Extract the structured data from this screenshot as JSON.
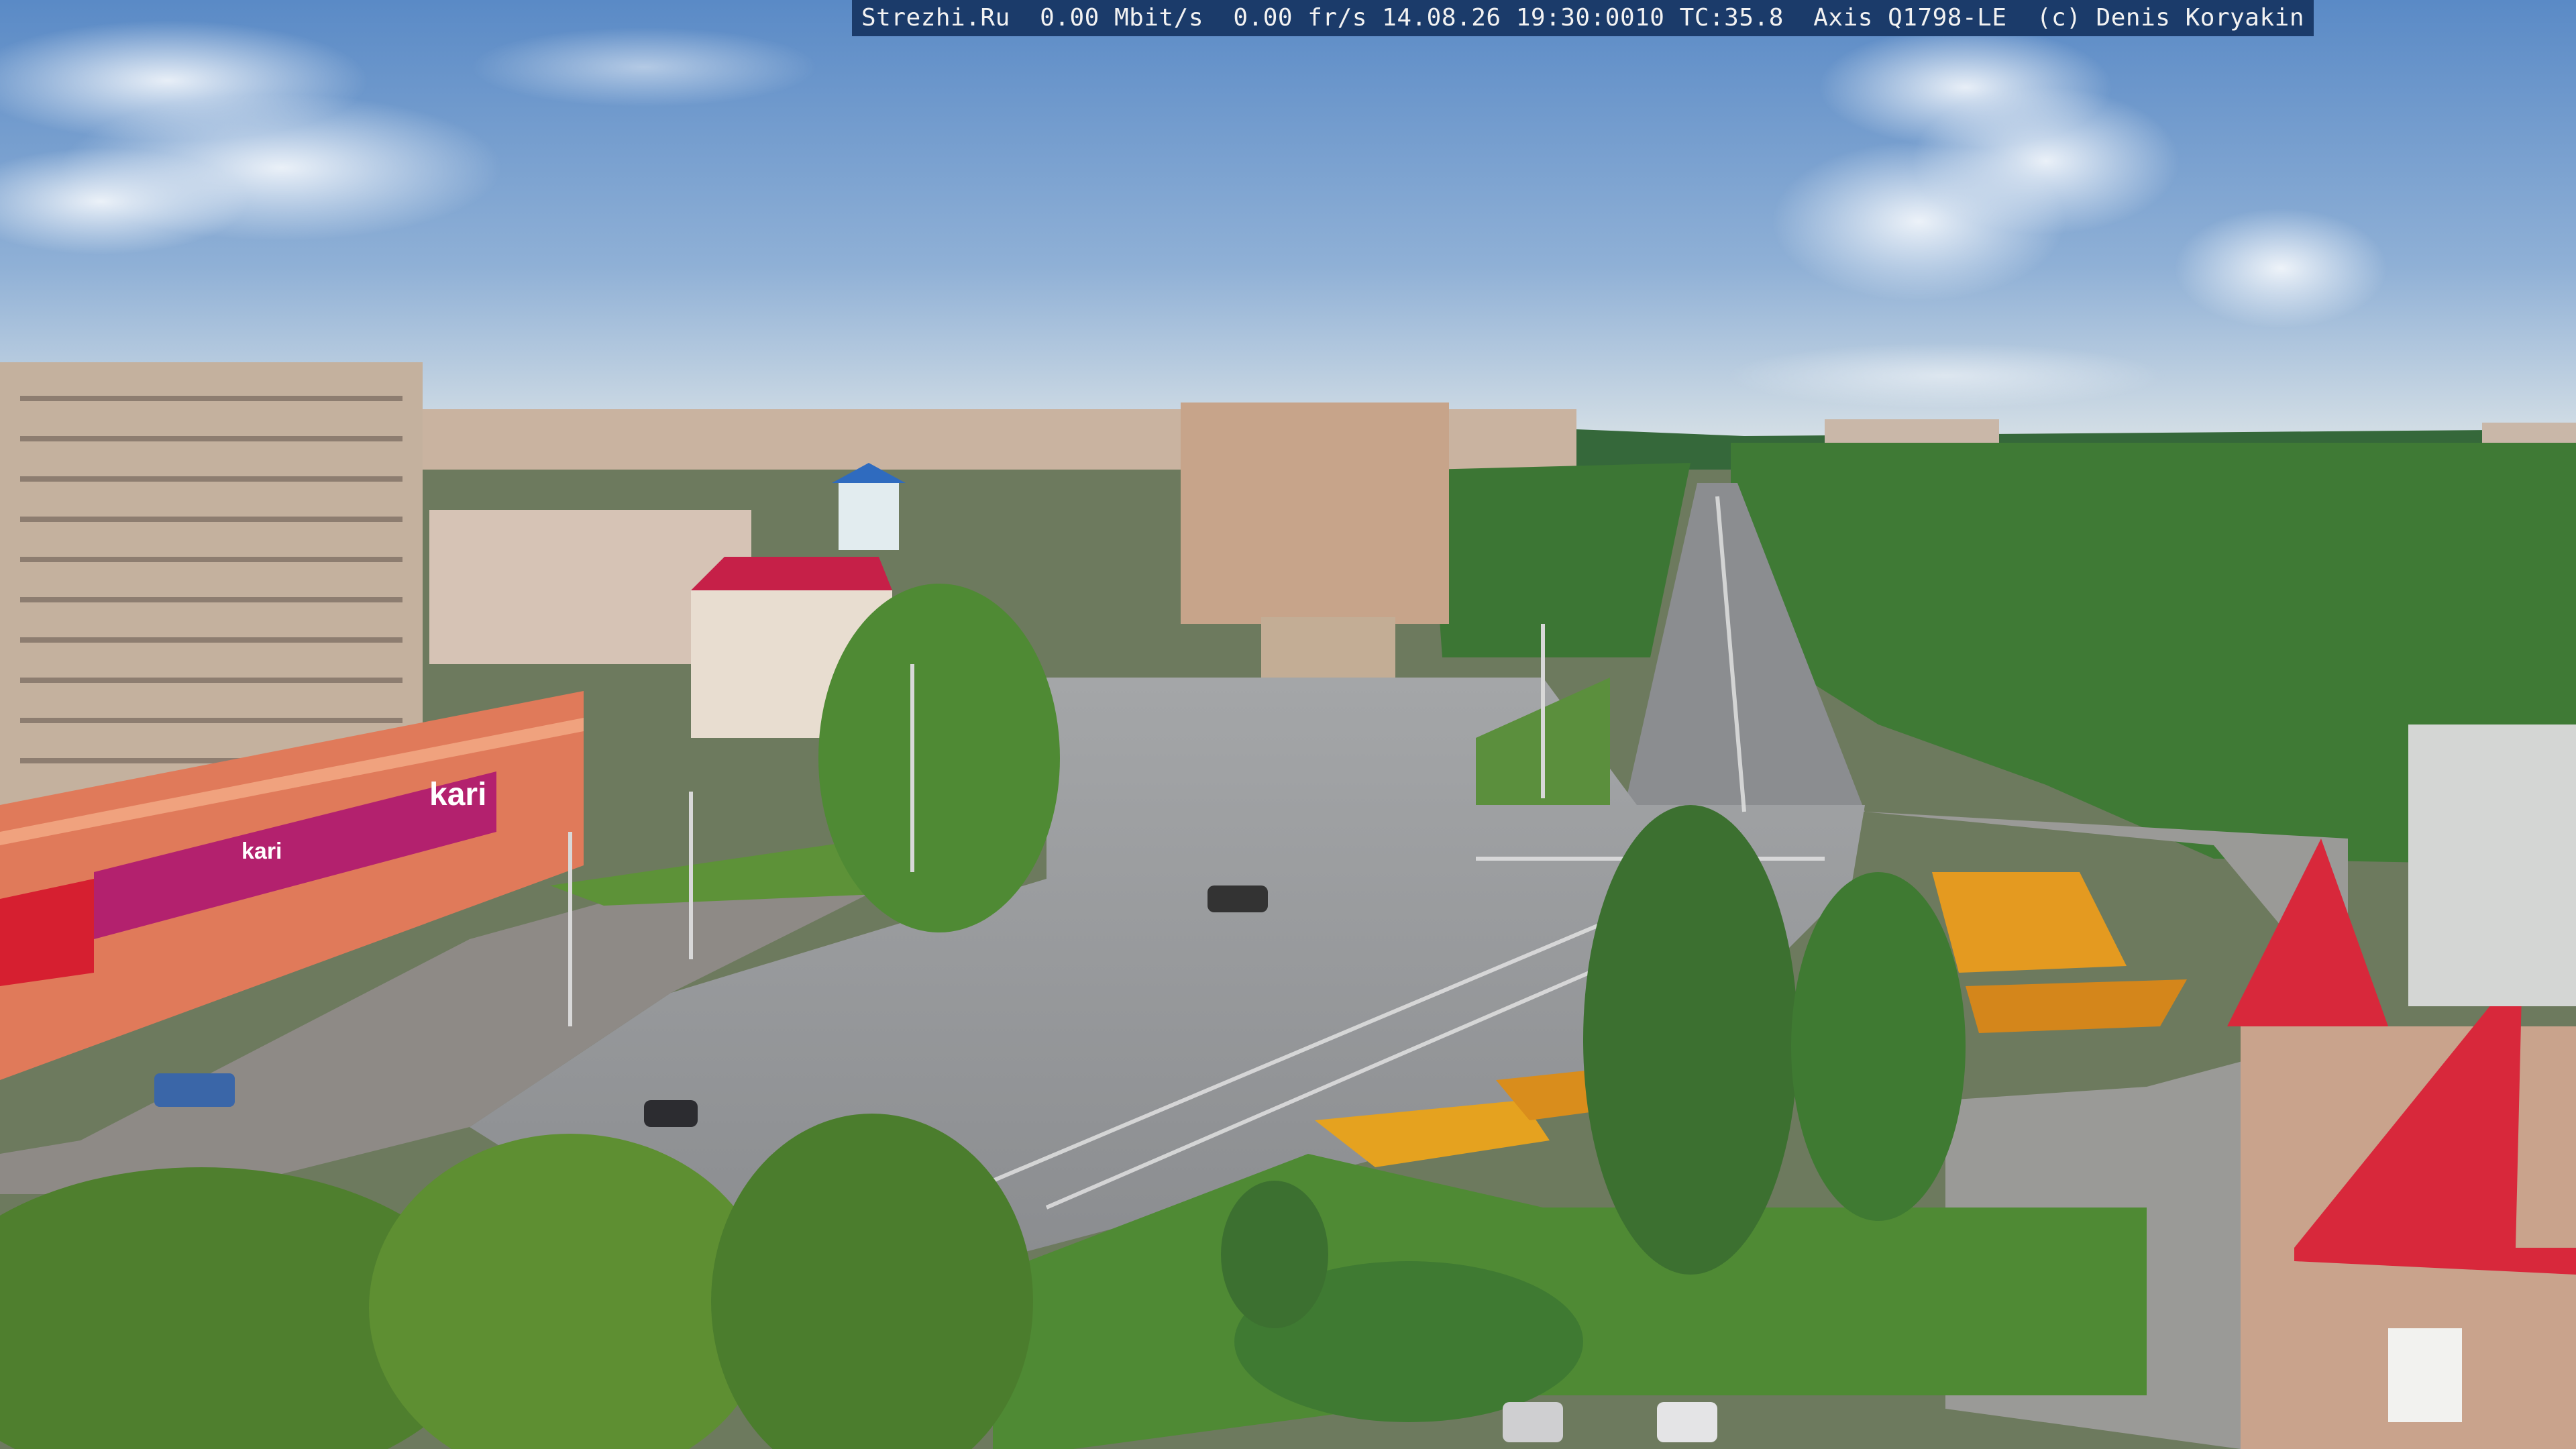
{
  "osd": {
    "site": "Strezhi.Ru",
    "bitrate": "0.00 Mbit/s",
    "framerate": "0.00 fr/s",
    "datetime": "14.08.26 19:30:0010",
    "temperature": "TC:35.8",
    "camera": "Axis Q1798-LE",
    "credit": "(c) Denis Koryakin"
  },
  "signage": {
    "store_sign": "kari",
    "store_sign_small": "kari"
  },
  "colors": {
    "sky_top": "#5f8ec7",
    "sky_bottom": "#c9d9e6",
    "forest": "#3f7a35",
    "road": "#8d8f92",
    "roof_red": "#d8283b"
  }
}
